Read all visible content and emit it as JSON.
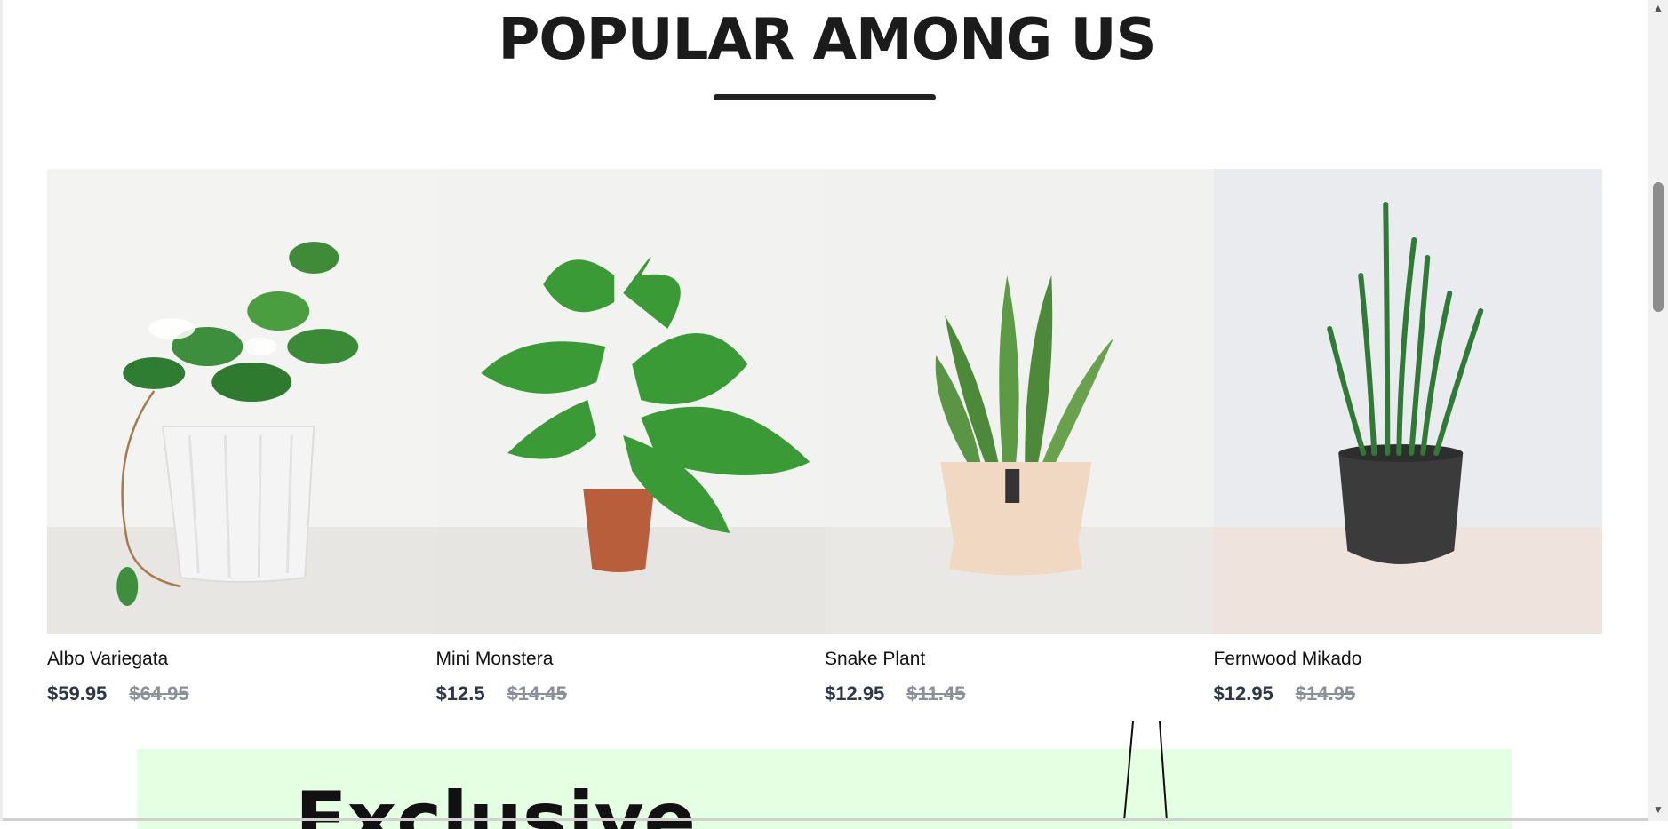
{
  "section": {
    "title": "POPULAR AMONG US"
  },
  "products": [
    {
      "name": "Albo Variegata",
      "price": "$59.95",
      "old_price": "$64.95"
    },
    {
      "name": "Mini Monstera",
      "price": "$12.5",
      "old_price": "$14.45"
    },
    {
      "name": "Snake Plant",
      "price": "$12.95",
      "old_price": "$11.45"
    },
    {
      "name": "Fernwood Mikado",
      "price": "$12.95",
      "old_price": "$14.95"
    }
  ],
  "banner": {
    "text": "Exclusive"
  },
  "colors": {
    "banner_bg": "#e4ffe2",
    "price": "#2d3748",
    "old_price": "#8a8f98"
  },
  "icons": [
    "scroll-up-arrow-icon",
    "scroll-down-arrow-icon"
  ]
}
